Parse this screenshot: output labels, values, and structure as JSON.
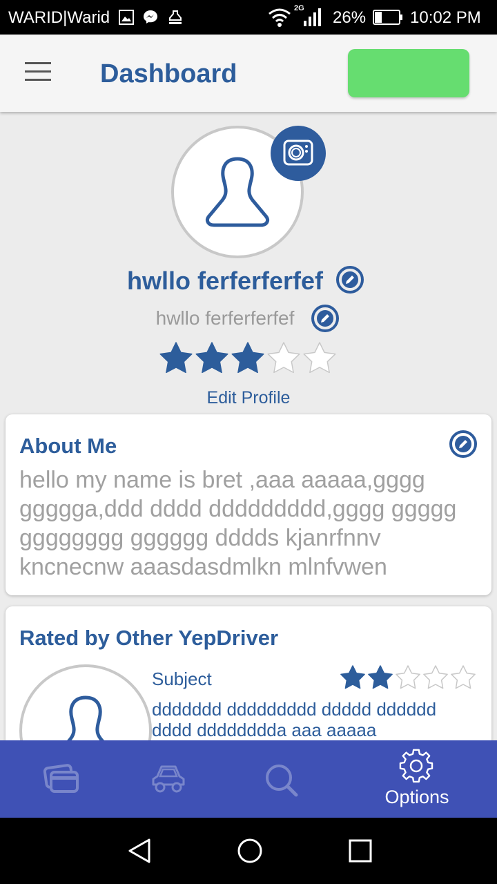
{
  "status_bar": {
    "carrier": "WARID|Warid",
    "network": "2G",
    "battery_percent": "26%",
    "time": "10:02 PM"
  },
  "header": {
    "title": "Dashboard",
    "accent_button_color": "#66dd70"
  },
  "profile": {
    "name": "hwllo ferferferfef",
    "username": "hwllo ferferferfef",
    "rating": 3,
    "max_rating": 5,
    "edit_profile_label": "Edit Profile"
  },
  "about": {
    "title": "About Me",
    "text": "hello  my name is bret ,aaa aaaaa,gggg ggggga,ddd dddd ddddddddd,gggg ggggg gggggggg gggggg dddds kjanrfnnv kncnecnw aaasdasdmlkn mlnfvwen"
  },
  "rated": {
    "title": "Rated by Other YepDriver",
    "review": {
      "subject": "Subject",
      "rating": 2,
      "max_rating": 5,
      "text": "ddddddd ddddddddd  ddddd dddddd dddd dddddddda aaa aaaaa"
    }
  },
  "bottom_nav": {
    "items": [
      {
        "icon": "cards-icon",
        "label": ""
      },
      {
        "icon": "car-icon",
        "label": ""
      },
      {
        "icon": "search-icon",
        "label": ""
      },
      {
        "icon": "gear-icon",
        "label": "Options"
      }
    ],
    "active_index": 3,
    "color": "#3f51b5"
  },
  "colors": {
    "primary": "#2d5d9b",
    "secondary_text": "#9a9a9a"
  }
}
